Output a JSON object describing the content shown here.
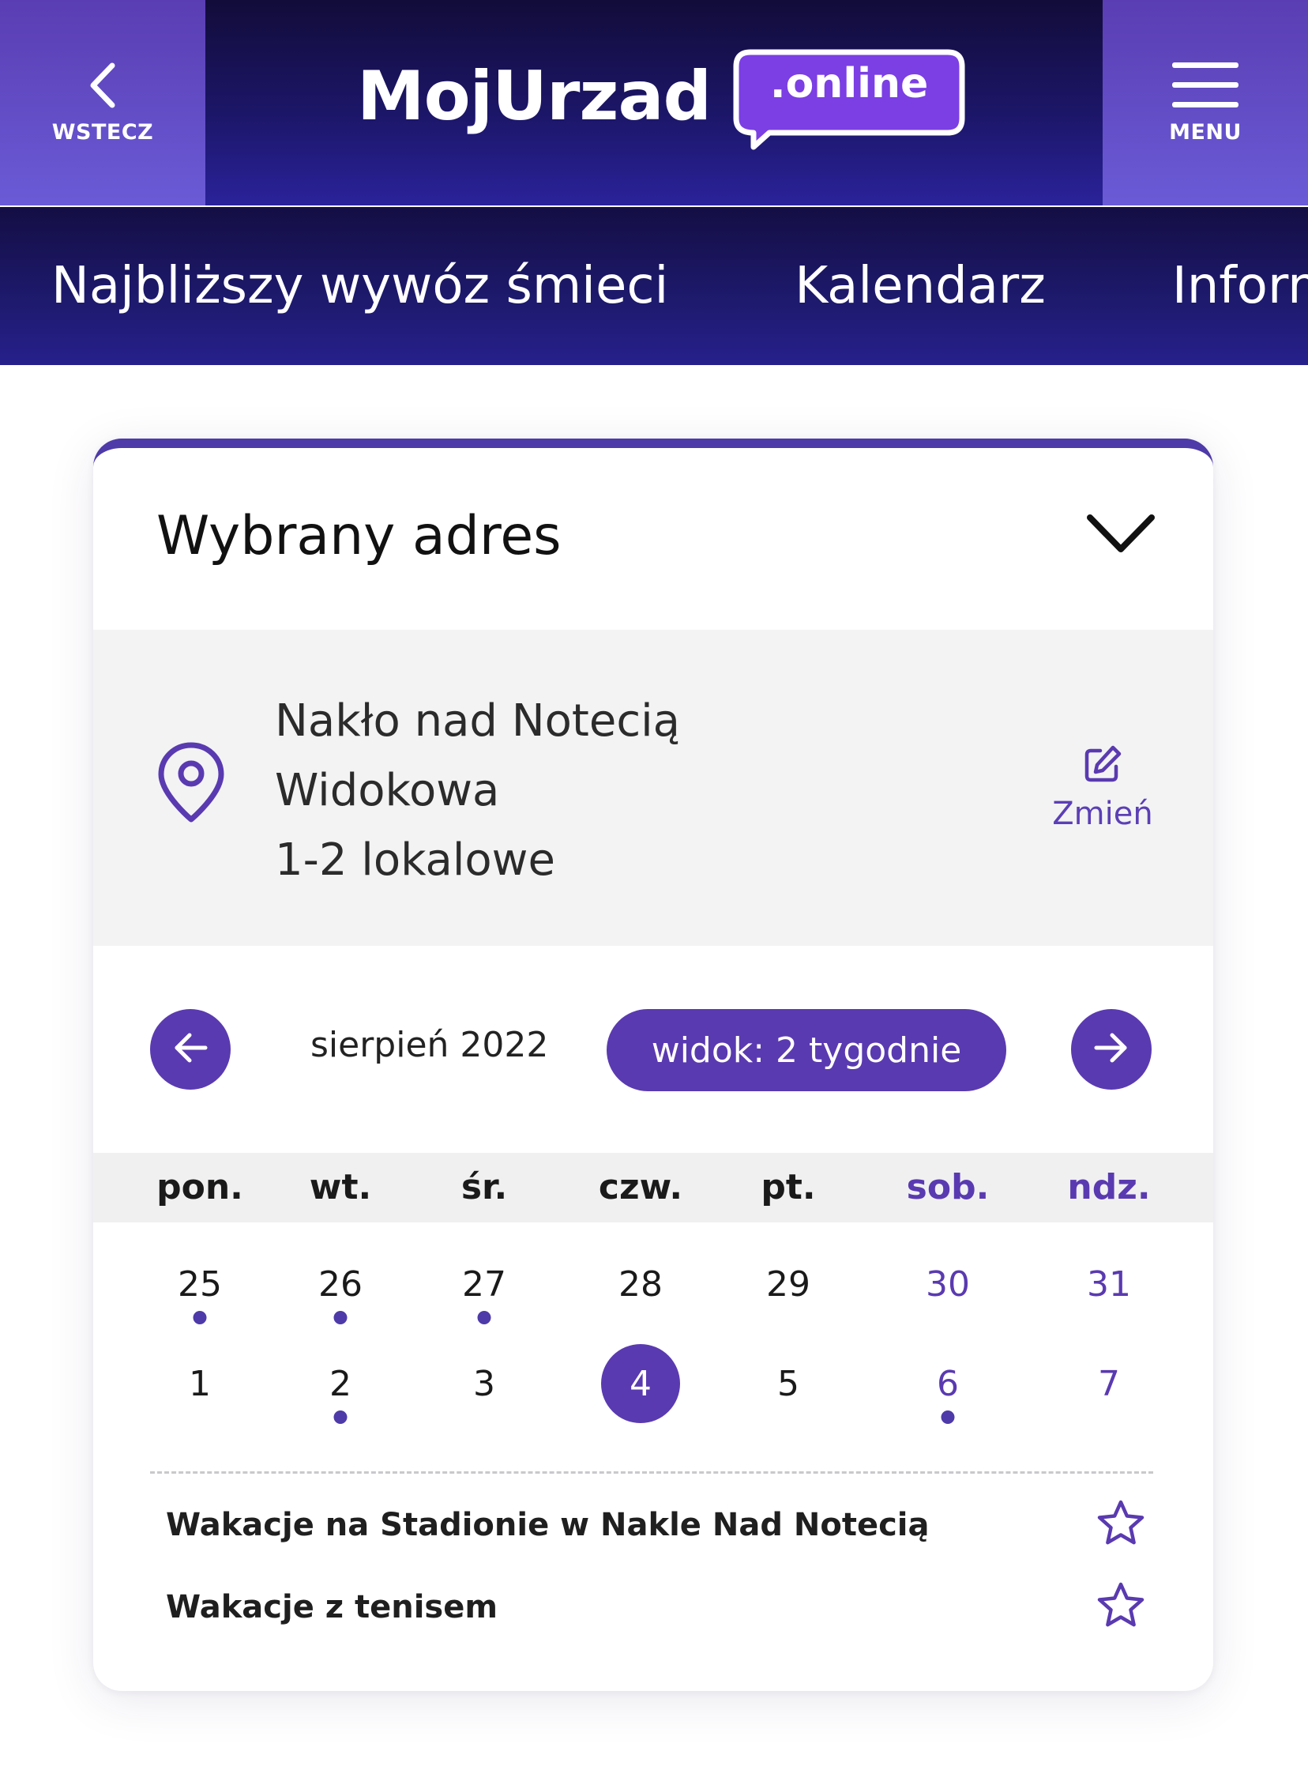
{
  "header": {
    "back_label": "WSTECZ",
    "brand_name": "MojUrzad",
    "brand_suffix": ".online",
    "menu_label": "MENU"
  },
  "tabs": [
    {
      "label": "Najbliższy wywóz śmieci"
    },
    {
      "label": "Kalendarz"
    },
    {
      "label": "Inform"
    }
  ],
  "address_card": {
    "title": "Wybrany adres",
    "lines": [
      "Nakło nad Notecią",
      "Widokowa",
      "1-2 lokalowe"
    ],
    "change_label": "Zmień"
  },
  "calendar": {
    "month_label": "sierpień 2022",
    "view_label": "widok: 2 tygodnie",
    "weekdays": [
      "pon.",
      "wt.",
      "śr.",
      "czw.",
      "pt.",
      "sob.",
      "ndz."
    ],
    "weekend_indices": [
      5,
      6
    ],
    "weeks": [
      [
        {
          "day": "25",
          "event": true
        },
        {
          "day": "26",
          "event": true
        },
        {
          "day": "27",
          "event": true
        },
        {
          "day": "28",
          "event": false
        },
        {
          "day": "29",
          "event": false
        },
        {
          "day": "30",
          "event": false
        },
        {
          "day": "31",
          "event": false
        }
      ],
      [
        {
          "day": "1",
          "event": false
        },
        {
          "day": "2",
          "event": true
        },
        {
          "day": "3",
          "event": false
        },
        {
          "day": "4",
          "event": false,
          "today": true
        },
        {
          "day": "5",
          "event": false
        },
        {
          "day": "6",
          "event": true
        },
        {
          "day": "7",
          "event": false
        }
      ]
    ]
  },
  "events": [
    {
      "title": "Wakacje na Stadionie w Nakle Nad Notecią"
    },
    {
      "title": "Wakacje z tenisem"
    }
  ],
  "colors": {
    "accent": "#5a3ab0",
    "header_dark": "#120c3a",
    "header_button": "#6a5bd6"
  },
  "icons": {
    "back": "chevron-left-icon",
    "menu": "hamburger-icon",
    "expand": "chevron-down-icon",
    "location": "map-pin-icon",
    "edit": "edit-icon",
    "prev": "arrow-left-icon",
    "next": "arrow-right-icon",
    "favorite": "star-icon"
  }
}
